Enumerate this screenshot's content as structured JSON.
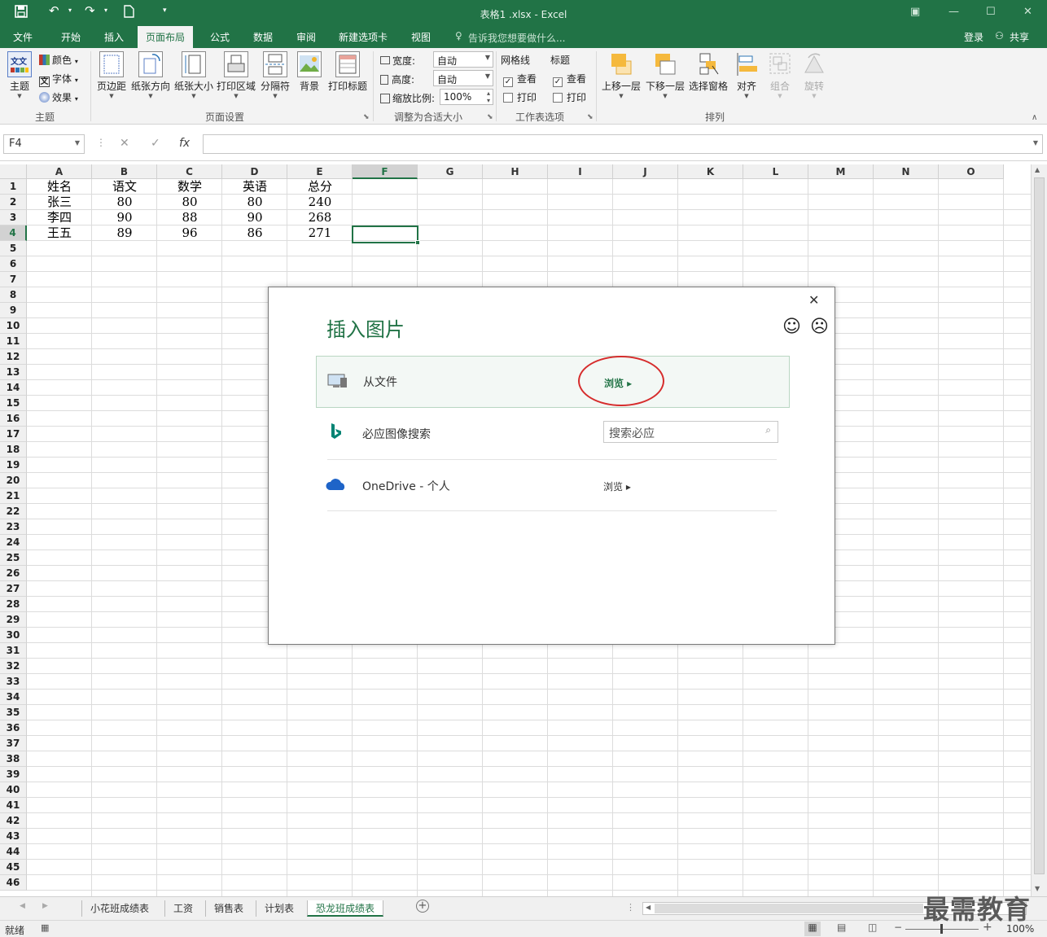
{
  "window": {
    "title": "表格1 .xlsx - Excel",
    "controls": [
      "restore-ribbon-icon",
      "minimize-icon",
      "maximize-icon",
      "close-icon"
    ]
  },
  "quick_access": {
    "save": "save-icon",
    "undo": "undo-icon",
    "redo": "redo-icon",
    "new": "new-doc-icon",
    "customize": "customize-icon"
  },
  "tabs": [
    {
      "label": "文件"
    },
    {
      "label": "开始"
    },
    {
      "label": "插入"
    },
    {
      "label": "页面布局",
      "active": true
    },
    {
      "label": "公式"
    },
    {
      "label": "数据"
    },
    {
      "label": "审阅"
    },
    {
      "label": "新建选项卡"
    },
    {
      "label": "视图"
    }
  ],
  "tell_me": "告诉我您想要做什么...",
  "account": {
    "login": "登录",
    "share": "共享"
  },
  "ribbon": {
    "theme": {
      "group": "主题",
      "themes": "主题",
      "colors": "颜色",
      "fonts": "字体",
      "effects": "效果"
    },
    "page_setup": {
      "group": "页面设置",
      "margins": "页边距",
      "orientation": "纸张方向",
      "size": "纸张大小",
      "print_area": "打印区域",
      "breaks": "分隔符",
      "background": "背景",
      "print_titles": "打印标题"
    },
    "scale": {
      "group": "调整为合适大小",
      "width_label": "宽度:",
      "width_value": "自动",
      "height_label": "高度:",
      "height_value": "自动",
      "scale_label": "缩放比例:",
      "scale_value": "100%"
    },
    "sheet_options": {
      "group": "工作表选项",
      "gridlines": "网格线",
      "headings": "标题",
      "view": "查看",
      "print": "打印",
      "gridlines_view": true,
      "gridlines_print": false,
      "headings_view": true,
      "headings_print": false
    },
    "arrange": {
      "group": "排列",
      "bring_forward": "上移一层",
      "send_backward": "下移一层",
      "selection_pane": "选择窗格",
      "align": "对齐",
      "group_btn": "组合",
      "rotate": "旋转"
    }
  },
  "formula_bar": {
    "name_box": "F4",
    "cancel": "✕",
    "enter": "✓",
    "fx": "fx",
    "content": ""
  },
  "columns": [
    "A",
    "B",
    "C",
    "D",
    "E",
    "F",
    "G",
    "H",
    "I",
    "J",
    "K",
    "L",
    "M",
    "N",
    "O"
  ],
  "selected_column": "F",
  "selected_row": 4,
  "rows": [
    "1",
    "2",
    "3",
    "4",
    "5",
    "6",
    "7",
    "8",
    "9",
    "10",
    "11",
    "12",
    "13",
    "14",
    "15",
    "16",
    "17",
    "18",
    "19",
    "20",
    "21",
    "22",
    "23",
    "24",
    "25",
    "26",
    "27",
    "28",
    "29",
    "30",
    "31",
    "32",
    "33",
    "34",
    "35",
    "36",
    "37",
    "38",
    "39",
    "40",
    "41",
    "42",
    "43",
    "44",
    "45",
    "46"
  ],
  "table": {
    "headers": [
      "姓名",
      "语文",
      "数学",
      "英语",
      "总分"
    ],
    "rows": [
      [
        "张三",
        "80",
        "80",
        "80",
        "240"
      ],
      [
        "李四",
        "90",
        "88",
        "90",
        "268"
      ],
      [
        "王五",
        "89",
        "96",
        "86",
        "271"
      ]
    ]
  },
  "dialog": {
    "title": "插入图片",
    "close": "✕",
    "feedback_happy": "☺",
    "feedback_sad": "☹",
    "options": [
      {
        "label": "从文件",
        "action": "浏览 ▸"
      },
      {
        "label": "必应图像搜索",
        "placeholder": "搜索必应"
      },
      {
        "label": "OneDrive - 个人",
        "action": "浏览 ▸"
      }
    ]
  },
  "sheets": [
    {
      "label": "小花班成绩表"
    },
    {
      "label": "工资"
    },
    {
      "label": "销售表"
    },
    {
      "label": "计划表"
    },
    {
      "label": "恐龙班成绩表",
      "active": true
    }
  ],
  "status": {
    "mode": "就绪",
    "zoom": "100%"
  },
  "watermark": "最需教育",
  "colors": {
    "accent": "#217346",
    "annotation": "#d62c2c"
  }
}
